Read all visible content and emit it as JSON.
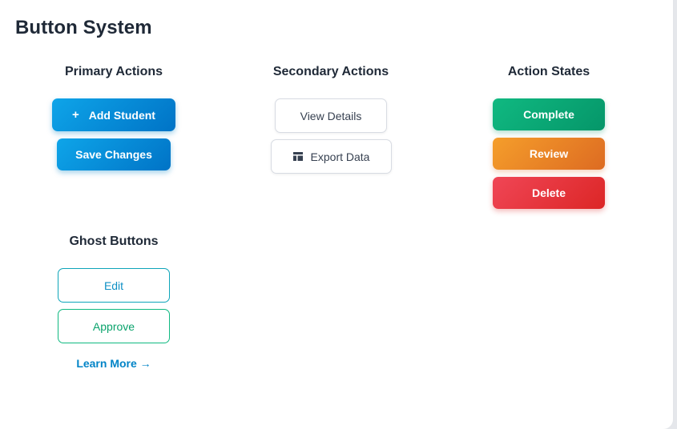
{
  "page": {
    "title": "Button System"
  },
  "primary": {
    "title": "Primary Actions",
    "add_student_icon": "plus-icon",
    "add_student_label": "Add Student",
    "save_changes_label": "Save Changes"
  },
  "secondary": {
    "title": "Secondary Actions",
    "view_details_label": "View Details",
    "export_icon": "table-icon",
    "export_data_label": "Export Data"
  },
  "states": {
    "title": "Action States",
    "complete_label": "Complete",
    "review_label": "Review",
    "delete_label": "Delete"
  },
  "ghost": {
    "title": "Ghost Buttons",
    "edit_label": "Edit",
    "approve_label": "Approve",
    "learn_more_label": "Learn More →"
  },
  "colors": {
    "primary": "#0284c7",
    "success": "#059669",
    "warning": "#dd6b22",
    "danger": "#dc2626",
    "text": "#1f2937"
  }
}
